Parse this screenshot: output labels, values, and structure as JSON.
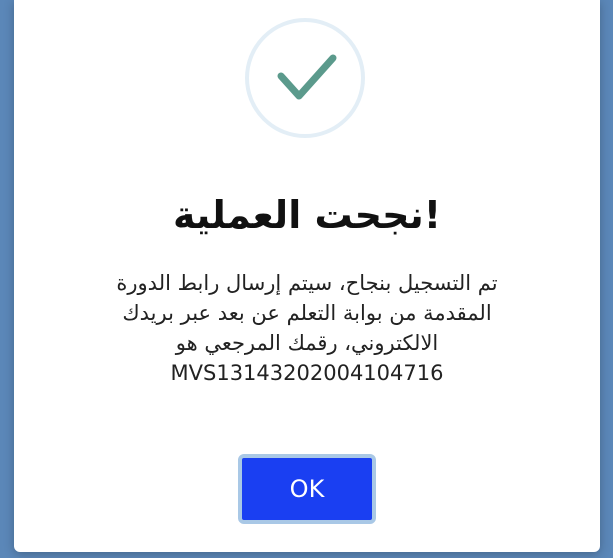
{
  "dialog": {
    "icon": "check-icon",
    "title": "!نجحت العملية",
    "message_lines": [
      "تم التسجيل بنجاح، سيتم إرسال رابط الدورة",
      "المقدمة من بوابة التعلم عن بعد عبر بريدك",
      "الالكتروني، رقمك المرجعي هو",
      "MVS13143202004104716"
    ],
    "ok_label": "OK"
  },
  "colors": {
    "backdrop": "#5b87b8",
    "check": "#5b9a8c",
    "ring": "#e3eef6",
    "button": "#1a3ff2",
    "button_border": "#a9c8e6"
  }
}
